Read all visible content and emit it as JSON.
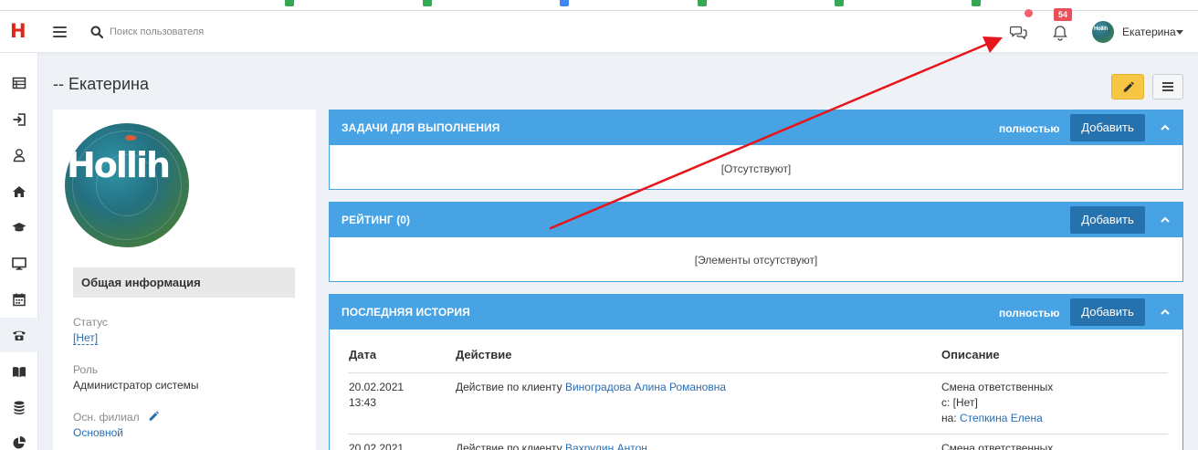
{
  "colors": {
    "brand_red": "#e2231a",
    "panel_blue": "#48a3e4",
    "add_button_blue": "#2672ae",
    "edit_button_yellow": "#f6c644",
    "link_blue": "#2a6db0",
    "annotation_red": "#e8141b"
  },
  "topbar": {
    "search_placeholder": "Поиск пользователя",
    "notification_count": "54",
    "user_name": "Екатерина",
    "user_avatar_text": "Hollih"
  },
  "sidebar": {
    "items": [
      {
        "icon": "table-list-icon"
      },
      {
        "icon": "sign-in-icon"
      },
      {
        "icon": "user-icon"
      },
      {
        "icon": "home-icon"
      },
      {
        "icon": "graduation-cap-icon"
      },
      {
        "icon": "desktop-icon"
      },
      {
        "icon": "calendar-icon"
      },
      {
        "icon": "phone-icon",
        "active": true
      },
      {
        "icon": "book-icon"
      },
      {
        "icon": "coins-icon"
      },
      {
        "icon": "pie-chart-icon"
      }
    ]
  },
  "page": {
    "title": "-- Екатерина"
  },
  "profile": {
    "avatar_text": "Hollih",
    "section_title": "Общая информация",
    "status_label": "Статус",
    "status_value": "[Нет]",
    "role_label": "Роль",
    "role_value": "Администратор системы",
    "branch_label": "Осн. филиал",
    "branch_value": "Основной"
  },
  "panels": {
    "tasks": {
      "title": "ЗАДАЧИ ДЛЯ ВЫПОЛНЕНИЯ",
      "full_label": "полностью",
      "add_label": "Добавить",
      "empty_text": "[Отсутствуют]"
    },
    "rating": {
      "title": "РЕЙТИНГ (0)",
      "add_label": "Добавить",
      "empty_text": "[Элементы отсутствуют]"
    },
    "history": {
      "title": "ПОСЛЕДНЯЯ ИСТОРИЯ",
      "full_label": "полностью",
      "add_label": "Добавить",
      "columns": [
        "Дата",
        "Действие",
        "Описание"
      ],
      "rows": [
        {
          "date": "20.02.2021",
          "time": "13:43",
          "action_prefix": "Действие по клиенту",
          "action_link": "Виноградова Алина Романовна",
          "desc_line1": "Смена ответственных",
          "desc_line2": "с: [Нет]",
          "desc_line3_prefix": "на:",
          "desc_line3_link": "Степкина Елена"
        },
        {
          "date": "20.02.2021",
          "action_prefix": "Действие по клиенту",
          "action_link": "Вахрулин Антон",
          "desc_line1": "Смена ответственных"
        }
      ]
    }
  }
}
